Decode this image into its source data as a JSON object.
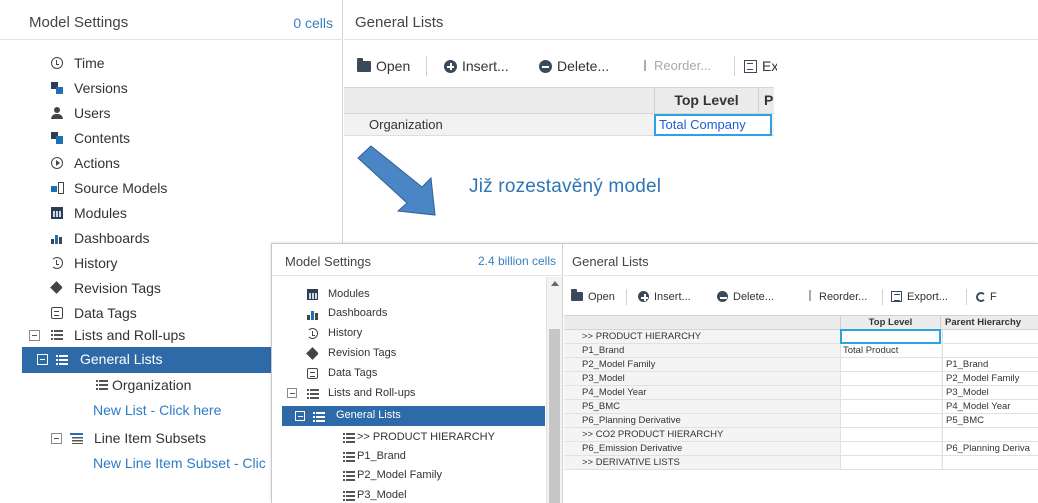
{
  "background": {
    "sidebar": {
      "title": "Model Settings",
      "cells": "0 cells",
      "items": [
        {
          "label": "Time",
          "icon": "clock-icon"
        },
        {
          "label": "Versions",
          "icon": "versions-icon"
        },
        {
          "label": "Users",
          "icon": "user-icon"
        },
        {
          "label": "Contents",
          "icon": "contents-icon"
        },
        {
          "label": "Actions",
          "icon": "play-circle-icon"
        },
        {
          "label": "Source Models",
          "icon": "source-models-icon"
        },
        {
          "label": "Modules",
          "icon": "modules-icon"
        },
        {
          "label": "Dashboards",
          "icon": "dashboards-icon"
        },
        {
          "label": "History",
          "icon": "history-icon"
        },
        {
          "label": "Revision Tags",
          "icon": "tag-icon"
        },
        {
          "label": "Data Tags",
          "icon": "data-tag-icon"
        },
        {
          "label": "Lists and Roll-ups",
          "icon": "list-icon"
        },
        {
          "label": "General Lists",
          "icon": "list-icon"
        },
        {
          "label": "Organization",
          "icon": "list-icon"
        },
        {
          "label": "New List - Click here",
          "icon": ""
        },
        {
          "label": "Line Item Subsets",
          "icon": "line-items-icon"
        },
        {
          "label": "New Line Item Subset - Clic",
          "icon": ""
        }
      ]
    },
    "main": {
      "title": "General Lists",
      "toolbar": {
        "open": "Open",
        "insert": "Insert...",
        "delete": "Delete...",
        "reorder": "Reorder...",
        "export": "Ex"
      },
      "grid": {
        "columns": [
          "Top Level",
          "P"
        ],
        "rows": [
          {
            "name": "Organization",
            "top_level": "Total Company"
          }
        ]
      }
    }
  },
  "callout": {
    "text": "Již rozestavěný model",
    "color": "#2e75b6"
  },
  "overlay": {
    "sidebar": {
      "title": "Model Settings",
      "cells": "2.4 billion cells",
      "items": [
        {
          "label": "Modules",
          "icon": "modules-icon"
        },
        {
          "label": "Dashboards",
          "icon": "dashboards-icon"
        },
        {
          "label": "History",
          "icon": "history-icon"
        },
        {
          "label": "Revision Tags",
          "icon": "tag-icon"
        },
        {
          "label": "Data Tags",
          "icon": "data-tag-icon"
        },
        {
          "label": "Lists and Roll-ups",
          "icon": "list-icon"
        },
        {
          "label": "General Lists",
          "icon": "list-icon"
        },
        {
          "label": ">> PRODUCT HIERARCHY",
          "icon": "list-icon"
        },
        {
          "label": "P1_Brand",
          "icon": "list-icon"
        },
        {
          "label": "P2_Model Family",
          "icon": "list-icon"
        },
        {
          "label": "P3_Model",
          "icon": "list-icon"
        }
      ]
    },
    "main": {
      "title": "General Lists",
      "toolbar": {
        "open": "Open",
        "insert": "Insert...",
        "delete": "Delete...",
        "reorder": "Reorder...",
        "export": "Export...",
        "more": "F"
      },
      "grid": {
        "columns": [
          "Top Level",
          "Parent Hierarchy"
        ],
        "rows": [
          {
            "name": ">> PRODUCT HIERARCHY",
            "top_level": "",
            "parent": ""
          },
          {
            "name": "P1_Brand",
            "top_level": "Total Product",
            "parent": ""
          },
          {
            "name": "P2_Model Family",
            "top_level": "",
            "parent": "P1_Brand"
          },
          {
            "name": "P3_Model",
            "top_level": "",
            "parent": "P2_Model Family"
          },
          {
            "name": "P4_Model Year",
            "top_level": "",
            "parent": "P3_Model"
          },
          {
            "name": "P5_BMC",
            "top_level": "",
            "parent": "P4_Model Year"
          },
          {
            "name": "P6_Planning Derivative",
            "top_level": "",
            "parent": "P5_BMC"
          },
          {
            "name": ">> CO2 PRODUCT HIERARCHY",
            "top_level": "",
            "parent": ""
          },
          {
            "name": "P6_Emission Derivative",
            "top_level": "",
            "parent": "P6_Planning Deriva"
          },
          {
            "name": ">> DERIVATIVE LISTS",
            "top_level": "",
            "parent": ""
          }
        ]
      }
    }
  },
  "colors": {
    "selection": "#2e6aa8",
    "link": "#2f7bc6",
    "active_cell_border": "#2aa3e6",
    "arrow": "#4a86c5"
  }
}
